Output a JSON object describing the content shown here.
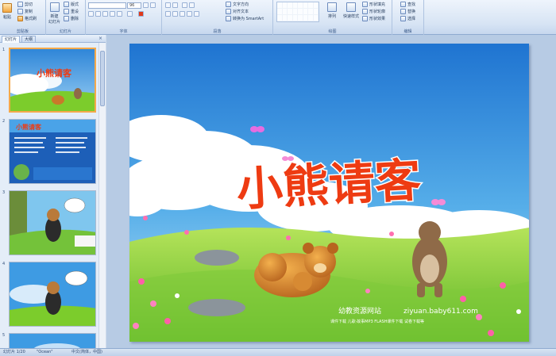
{
  "ribbon": {
    "clipboard": {
      "paste": "粘贴",
      "cut": "剪切",
      "copy": "复制",
      "format_painter": "格式刷",
      "label": "剪贴板"
    },
    "slides": {
      "new_slide": "新建\n幻灯片",
      "layout": "版式",
      "reset": "重设",
      "delete": "删除",
      "label": "幻灯片"
    },
    "font": {
      "font_size": "96",
      "label": "字体"
    },
    "paragraph": {
      "text_direction": "文字方向",
      "align_text": "对齐文本",
      "convert_smartart": "转换为 SmartArt",
      "label": "段落"
    },
    "drawing": {
      "arrange": "排列",
      "quick_styles": "快速样式",
      "shape_fill": "形状填充",
      "shape_outline": "形状轮廓",
      "shape_effects": "形状效果",
      "label": "绘图"
    },
    "editing": {
      "find": "查找",
      "replace": "替换",
      "select": "选择",
      "label": "编辑"
    }
  },
  "panel": {
    "tab_slides": "幻灯片",
    "tab_outline": "大纲",
    "close": "×"
  },
  "thumbnails": [
    {
      "num": "1",
      "title": "小熊请客"
    },
    {
      "num": "2",
      "title": "小熊请客"
    },
    {
      "num": "3",
      "title": ""
    },
    {
      "num": "4",
      "title": ""
    },
    {
      "num": "5",
      "title": ""
    }
  ],
  "slide": {
    "title": "小熊请客",
    "site_name": "幼教资源网站",
    "site_url": "ziyuan.baby611.com",
    "footer_items": "课件下载  儿歌·故事MP3  FLASH课件下载  试卷下载等"
  },
  "status": {
    "slide_index": "幻灯片 1/20",
    "theme": "\"Ocean\"",
    "language": "中文(简体，中国)"
  },
  "colors": {
    "sky_top": "#2f86d8",
    "title_red": "#ee3b12",
    "grass": "#7ccc2c",
    "ribbon": "#d7e4f4"
  }
}
